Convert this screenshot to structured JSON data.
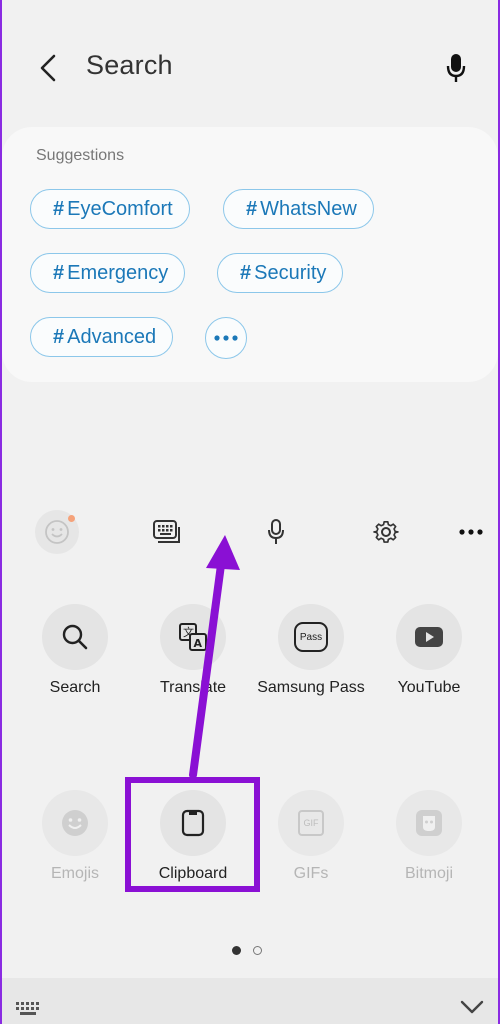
{
  "header": {
    "title": "Search"
  },
  "suggestions": {
    "label": "Suggestions",
    "chips": [
      {
        "hash": "#",
        "text": "EyeComfort"
      },
      {
        "hash": "#",
        "text": "WhatsNew"
      },
      {
        "hash": "#",
        "text": "Emergency"
      },
      {
        "hash": "#",
        "text": "Security"
      },
      {
        "hash": "#",
        "text": "Advanced"
      }
    ]
  },
  "grid": {
    "row1": [
      {
        "label": "Search",
        "icon": "search-icon"
      },
      {
        "label": "Translate",
        "icon": "translate-icon"
      },
      {
        "label": "Samsung Pass",
        "icon": "samsung-pass-icon",
        "badge": "Pass"
      },
      {
        "label": "YouTube",
        "icon": "youtube-icon"
      }
    ],
    "row2": [
      {
        "label": "Emojis",
        "icon": "emoji-icon"
      },
      {
        "label": "Clipboard",
        "icon": "clipboard-icon"
      },
      {
        "label": "GIFs",
        "icon": "gif-icon",
        "badge": "GIF"
      },
      {
        "label": "Bitmoji",
        "icon": "bitmoji-icon"
      }
    ]
  },
  "colors": {
    "accent": "#1b78b8",
    "chip_border": "#8cc7ea",
    "annotation": "#8a10d4"
  }
}
